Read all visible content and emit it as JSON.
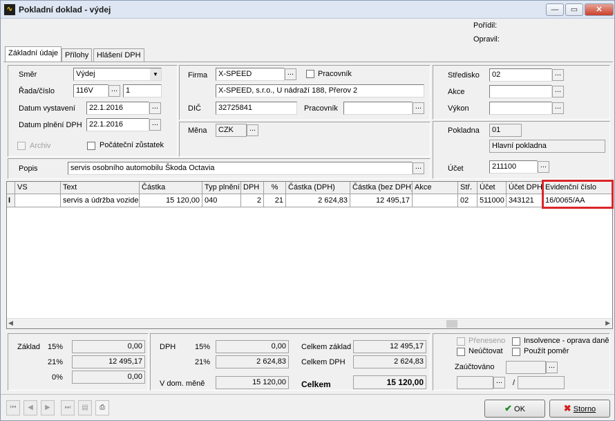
{
  "window": {
    "title": "Pokladní doklad - výdej",
    "minimize": "—",
    "maximize": "▭",
    "close": "✕"
  },
  "info": {
    "porizil": "Pořídil:",
    "opravil": "Opravil:"
  },
  "tabs": [
    "Základní údaje",
    "Přílohy",
    "Hlášení DPH"
  ],
  "left": {
    "smer_label": "Směr",
    "smer_value": "Výdej",
    "rada_label": "Řada/číslo",
    "rada_value": "116V",
    "cislo_value": "1",
    "datum_vyst_label": "Datum vystavení",
    "datum_vyst_value": "22.1.2016",
    "datum_dph_label": "Datum plnění DPH",
    "datum_dph_value": "22.1.2016",
    "archiv_label": "Archiv",
    "pocatecni_label": "Počáteční zůstatek"
  },
  "middle": {
    "firma_label": "Firma",
    "firma_value": "X-SPEED",
    "pracovnik_cb_label": "Pracovník",
    "firma_full": "X-SPEED, s.r.o., U nádraží 188, Přerov 2",
    "dic_label": "DIČ",
    "dic_value": "32725841",
    "pracovnik_label": "Pracovník",
    "mena_label": "Měna",
    "mena_value": "CZK"
  },
  "right": {
    "stredisko_label": "Středisko",
    "stredisko_value": "02",
    "akce_label": "Akce",
    "vykon_label": "Výkon",
    "pokladna_label": "Pokladna",
    "pokladna_value": "01",
    "pokladna_name": "Hlavní pokladna",
    "ucet_label": "Účet",
    "ucet_value": "211100"
  },
  "popis": {
    "label": "Popis",
    "value": "servis osobního automobilu Škoda Octavia"
  },
  "table": {
    "headers": [
      "VS",
      "Text",
      "Částka",
      "Typ plnění",
      "DPH",
      "%",
      "Částka (DPH)",
      "Částka (bez DPH)",
      "Akce",
      "Stř.",
      "Účet",
      "Účet DPH",
      "Evidenční číslo"
    ],
    "row": {
      "marker": "I",
      "vs": "",
      "text": "servis a údržba vozidel",
      "castka": "15 120,00",
      "typ": "040",
      "dph": "2",
      "pct": "21",
      "castka_dph": "2 624,83",
      "castka_bez": "12 495,17",
      "akce": "",
      "str": "02",
      "ucet": "511000",
      "ucet_dph": "343121",
      "evid": "16/0065/AA"
    },
    "highlight_color": "#d9252a"
  },
  "summary": {
    "zaklad_label": "Základ",
    "p15": "15%",
    "p21": "21%",
    "p0": "0%",
    "z15": "0,00",
    "z21": "12 495,17",
    "z0": "0,00",
    "dph_label": "DPH",
    "d15": "0,00",
    "d21": "2 624,83",
    "vdom_label": "V dom. měně",
    "vdom_value": "15 120,00",
    "celkem_zaklad_label": "Celkem základ",
    "celkem_zaklad_value": "12 495,17",
    "celkem_dph_label": "Celkem DPH",
    "celkem_dph_value": "2 624,83",
    "celkem_label": "Celkem",
    "celkem_value": "15 120,00"
  },
  "flags": {
    "preneseno": "Přeneseno",
    "insolvence": "Insolvence - oprava daně",
    "neuctovat": "Neúčtovat",
    "pouzit": "Použít poměr",
    "zauctovano": "Zaúčtováno",
    "slash": "/"
  },
  "buttons": {
    "ok": "OK",
    "storno": "Storno",
    "dots": "..."
  }
}
